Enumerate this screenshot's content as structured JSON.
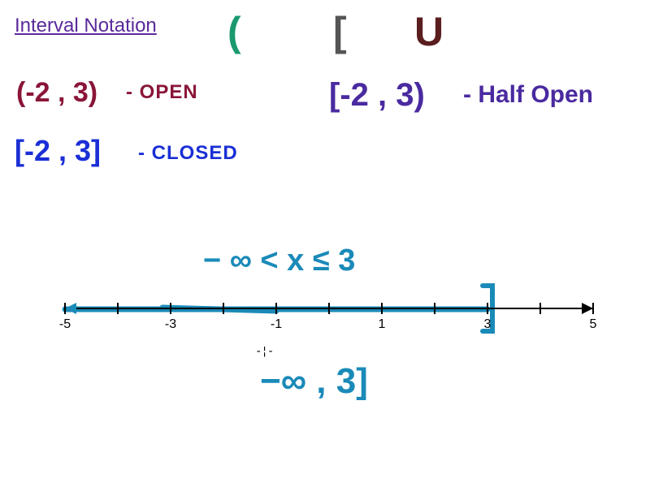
{
  "title": "Interval Notation",
  "symbols": {
    "paren": "(",
    "bracket": "[",
    "union": "U"
  },
  "examples": {
    "open": {
      "interval": "(-2 , 3)",
      "label": "- OPEN"
    },
    "closed": {
      "interval": "[-2 , 3]",
      "label": "- CLOSED"
    },
    "half": {
      "interval": "[-2 , 3)",
      "label": "- Half Open"
    }
  },
  "inequality": "− ∞  <  x ≤ 3",
  "answer": "−∞ , 3]",
  "numberline": {
    "ticks": [
      {
        "v": -5,
        "label": "-5"
      },
      {
        "v": -4,
        "label": ""
      },
      {
        "v": -3,
        "label": "-3"
      },
      {
        "v": -2,
        "label": ""
      },
      {
        "v": -1,
        "label": "-1"
      },
      {
        "v": 0,
        "label": ""
      },
      {
        "v": 1,
        "label": "1"
      },
      {
        "v": 2,
        "label": ""
      },
      {
        "v": 3,
        "label": "3"
      },
      {
        "v": 4,
        "label": ""
      },
      {
        "v": 5,
        "label": "5"
      }
    ],
    "highlight_to": 3
  },
  "cursor": "-¦-"
}
